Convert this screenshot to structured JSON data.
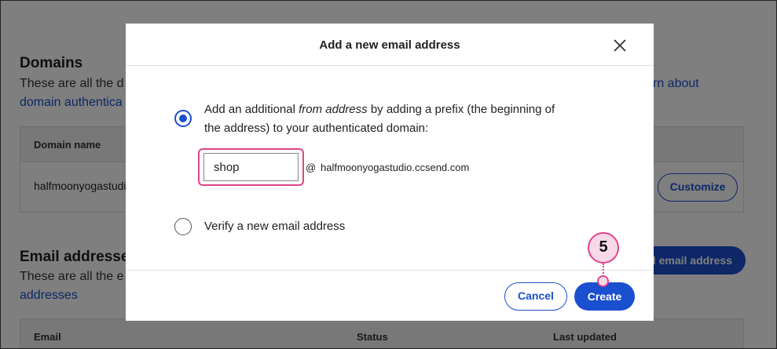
{
  "background": {
    "domains": {
      "title": "Domains",
      "description": "These are all the d",
      "description_right_link": "rn about",
      "link": "domain authentica",
      "table": {
        "header": "Domain name",
        "row_value": "halfmoonyogastudio",
        "row_button": "Customize"
      }
    },
    "emails": {
      "title": "Email addresse",
      "description": "These are all the e",
      "link": "addresses",
      "add_button": "d email address",
      "table": {
        "col_email": "Email",
        "col_status": "Status",
        "col_updated": "Last updated"
      }
    }
  },
  "modal": {
    "title": "Add a new email address",
    "option1": {
      "text_before": "Add an additional ",
      "text_italic": "from address",
      "text_after": " by adding a prefix (the beginning of",
      "text_line2": "the address) to your authenticated domain:",
      "selected": true
    },
    "prefix_value": "shop",
    "at_symbol": "@",
    "domain": "halfmoonyogastudio.ccsend.com",
    "option2": {
      "text": "Verify a new email address",
      "selected": false
    },
    "cancel_label": "Cancel",
    "create_label": "Create"
  },
  "step_badge": "5",
  "colors": {
    "accent": "#1a4fcf",
    "highlight": "#e0458a",
    "badge_fill": "#f7d9e8"
  }
}
